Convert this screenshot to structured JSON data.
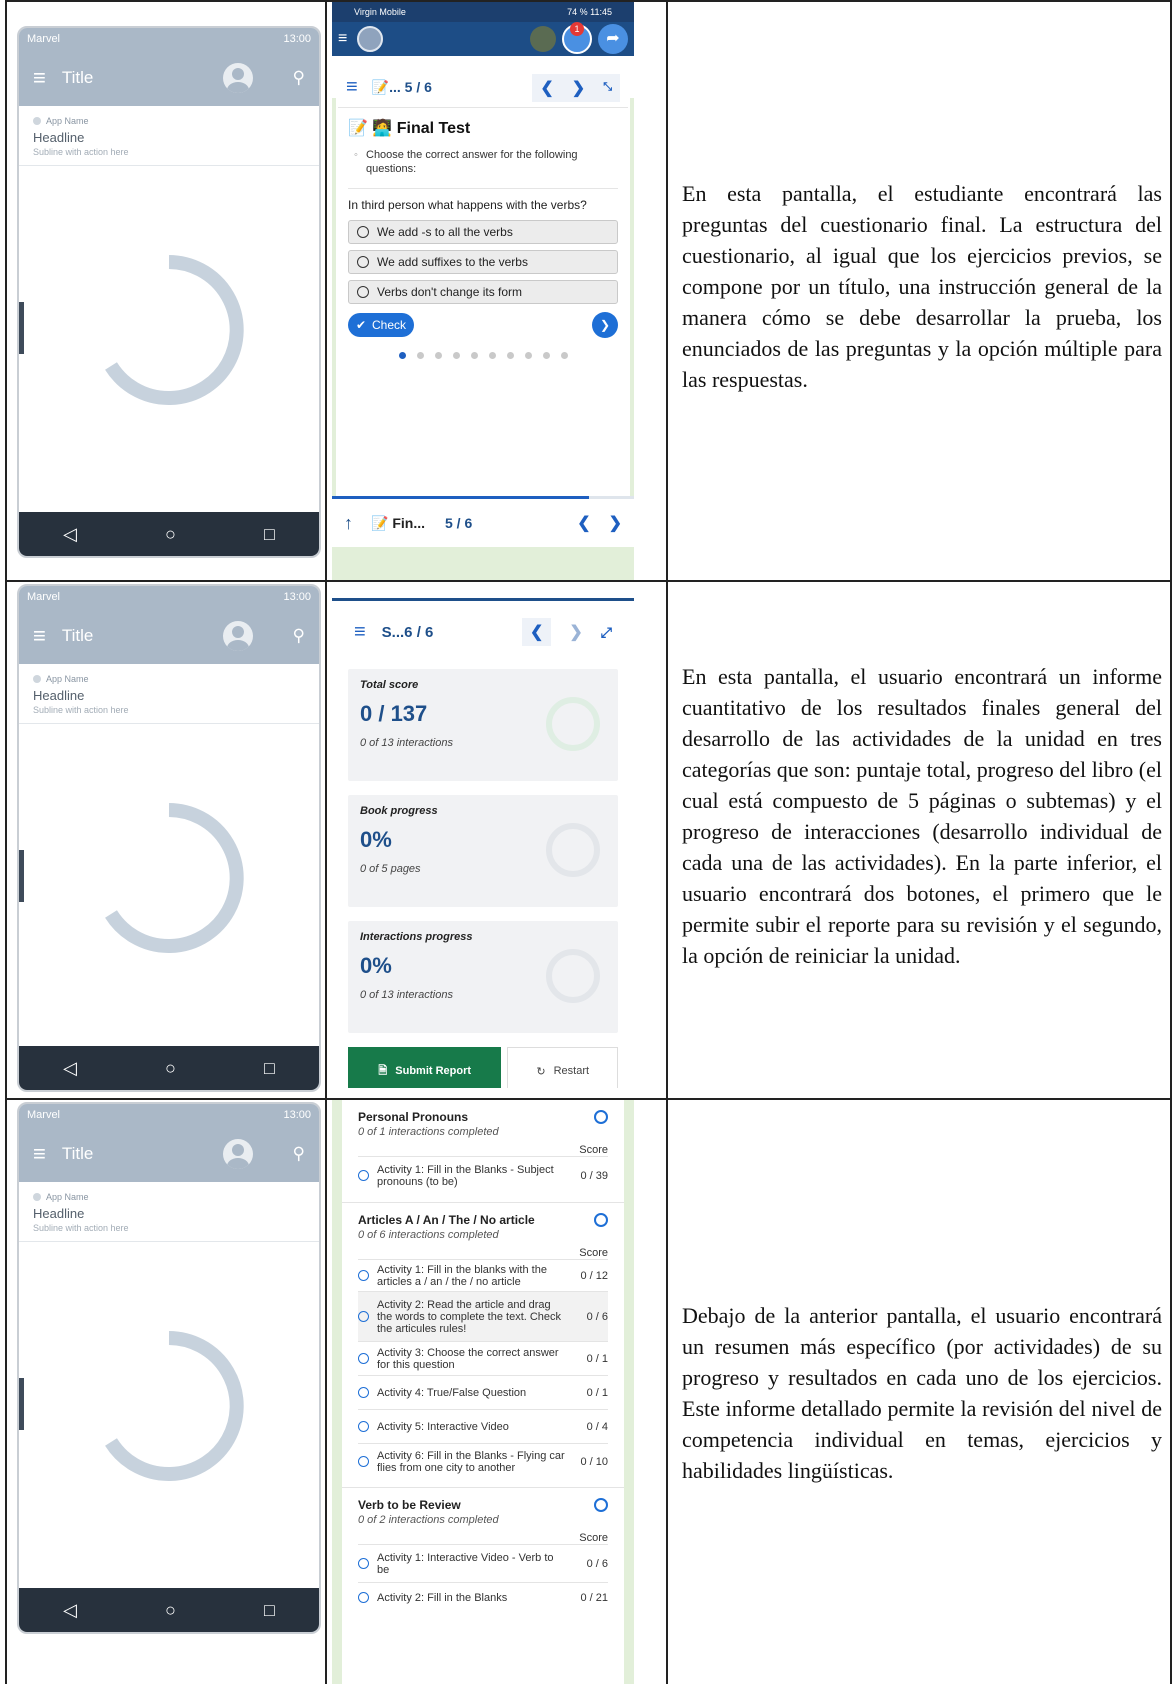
{
  "rows": [
    {
      "description": "En esta pantalla, el estudiante encontrará las preguntas del cuestionario final. La estructura del cuestionario, al igual que los ejercicios previos, se compone por un título, una instrucción general de la manera cómo se debe desarrollar la prueba, los enunciados de las preguntas y la opción múltiple para las respuestas."
    },
    {
      "description": "En esta pantalla, el usuario encontrará un informe cuantitativo de los resultados finales general del desarrollo de las actividades de la unidad en tres categorías que son: puntaje total, progreso del libro (el cual está compuesto de 5 páginas o subtemas) y el progreso de interacciones (desarrollo individual de cada una de las actividades). En la parte inferior, el usuario encontrará dos botones, el primero que le permite subir el reporte para su revisión y el segundo, la opción de reiniciar la unidad."
    },
    {
      "description": "Debajo de la anterior pantalla, el usuario encontrará un resumen más específico (por actividades) de su progreso y resultados en cada uno de los ejercicios. Este informe detallado permite la revisión del nivel de competencia individual en temas, ejercicios y habilidades lingüísticas."
    }
  ],
  "marvel": {
    "carrier": "Marvel",
    "time": "13:00",
    "title": "Title",
    "app_name": "App Name",
    "headline": "Headline",
    "subline": "Subline with action here",
    "nav_back": "◁",
    "nav_home": "○",
    "nav_recent": "□"
  },
  "quiz": {
    "status": "Virgin Mobile",
    "status_right": "74 % 11:45",
    "badge": "1",
    "breadcrumb": "📝...  5 / 6",
    "title": "📝 🧑‍💻 Final Test",
    "instruction": "Choose the correct answer for the following questions:",
    "question": "In third person what happens with the verbs?",
    "options": [
      "We add -s to all the verbs",
      "We add suffixes to the verbs",
      "Verbs don't change its form"
    ],
    "check_label": "Check",
    "footer_title": "📝 Fin...",
    "footer_page": "5 / 6"
  },
  "summary": {
    "breadcrumb": "S...6 / 6",
    "total_label": "Total score",
    "total_value": "0 / 137",
    "total_sub": "0 of 13 interactions",
    "book_label": "Book progress",
    "book_value": "0%",
    "book_sub": "0 of 5 pages",
    "inter_label": "Interactions progress",
    "inter_value": "0%",
    "inter_sub": "0 of 13 interactions",
    "submit_label": "Submit Report",
    "restart_label": "Restart"
  },
  "details": {
    "score_label": "Score",
    "sections": [
      {
        "title": "Personal Pronouns",
        "sub": "0 of 1 interactions completed",
        "activities": [
          {
            "text": "Activity 1: Fill in the Blanks - Subject pronouns (to be)",
            "score": "0 / 39"
          }
        ]
      },
      {
        "title": "Articles A / An / The / No article",
        "sub": "0 of 6 interactions completed",
        "activities": [
          {
            "text": "Activity 1: Fill in the blanks with the articles a / an / the / no article",
            "score": "0 / 12"
          },
          {
            "text": "Activity 2: Read the article and drag the words to complete the text. Check the articules rules!",
            "score": "0 / 6"
          },
          {
            "text": "Activity 3: Choose the correct answer for this question",
            "score": "0 / 1"
          },
          {
            "text": "Activity 4: True/False Question",
            "score": "0 / 1"
          },
          {
            "text": "Activity 5: Interactive Video",
            "score": "0 / 4"
          },
          {
            "text": "Activity 6: Fill in the Blanks - Flying car flies from one city to another",
            "score": "0 / 10"
          }
        ]
      },
      {
        "title": "Verb to be Review",
        "sub": "0 of 2 interactions completed",
        "activities": [
          {
            "text": "Activity 1: Interactive Video - Verb to be",
            "score": "0 / 6"
          },
          {
            "text": "Activity 2: Fill in the Blanks",
            "score": "0 / 21"
          }
        ]
      }
    ]
  }
}
